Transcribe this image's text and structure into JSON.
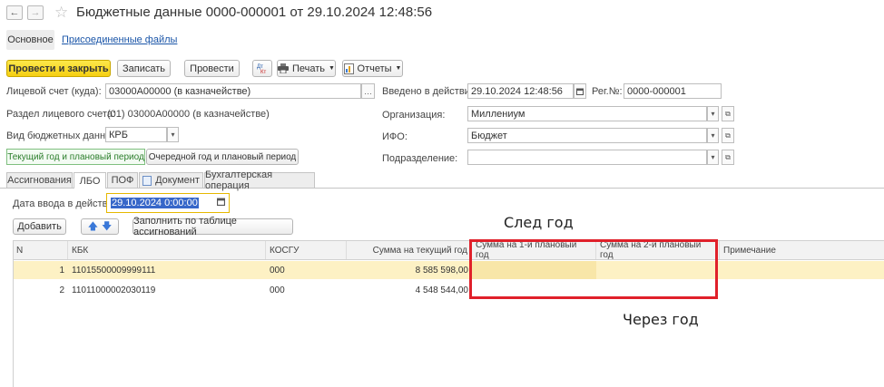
{
  "window": {
    "title": "Бюджетные данные 0000-000001 от 29.10.2024 12:48:56",
    "nav_back": "←",
    "nav_forward": "→",
    "star": "☆"
  },
  "page_tabs": {
    "main": "Основное",
    "files": "Присоединенные файлы"
  },
  "toolbar": {
    "post_close": "Провести и закрыть",
    "save": "Записать",
    "post": "Провести",
    "print": "Печать",
    "reports": "Отчеты"
  },
  "form": {
    "account_label": "Лицевой счет (куда):",
    "account_value": "03000А00000 (в казначействе)",
    "section_label": "Раздел лицевого счета:",
    "section_value": "(01) 03000А00000 (в казначействе)",
    "type_label": "Вид бюджетных данных:",
    "type_value": "КРБ",
    "effective_label": "Введено в действие:",
    "effective_value": "29.10.2024 12:48:56",
    "regno_label": "Рег.№:",
    "regno_value": "0000-000001",
    "org_label": "Организация:",
    "org_value": "Миллениум",
    "ifo_label": "ИФО:",
    "ifo_value": "Бюджет",
    "dept_label": "Подразделение:",
    "dept_value": ""
  },
  "period_buttons": {
    "current": "Текущий год и плановый период",
    "next": "Очередной год и плановый период"
  },
  "tabs": [
    "Ассигнования",
    "ЛБО",
    "ПОФ",
    "Документ",
    "Бухгалтерская операция"
  ],
  "lbo": {
    "date_label": "Дата ввода в действие:",
    "date_value": "29.10.2024  0:00:00",
    "add": "Добавить",
    "fill": "Заполнить по таблице ассигнований"
  },
  "table": {
    "columns": [
      "N",
      "КБК",
      "КОСГУ",
      "Сумма на текущий год",
      "Сумма на 1-й плановый год",
      "Сумма на 2-й плановый год",
      "Примечание"
    ],
    "rows": [
      {
        "n": "1",
        "kbk": "11015500009999111",
        "kosgu": "000",
        "sum_current": "8 585 598,00",
        "sum_1": "",
        "sum_2": "",
        "note": ""
      },
      {
        "n": "2",
        "kbk": "11011000002030119",
        "kosgu": "000",
        "sum_current": "4 548 544,00",
        "sum_1": "",
        "sum_2": "",
        "note": ""
      }
    ]
  },
  "annotations": {
    "next_year": "След год",
    "year_after": "Через год"
  },
  "colors": {
    "accent_yellow": "#f5cf12",
    "selected_row": "#fdf1c4",
    "highlight_box": "#e0202a",
    "link": "#1a55a8"
  }
}
